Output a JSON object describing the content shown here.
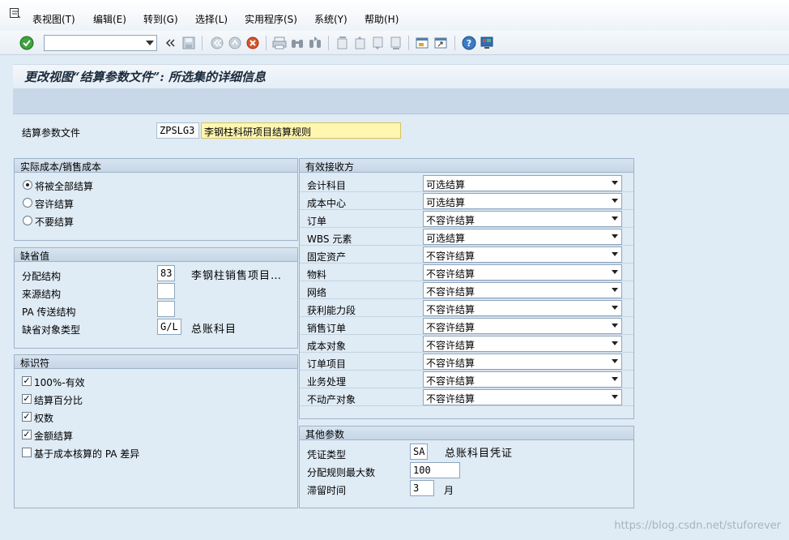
{
  "menu": {
    "items": [
      "表视图(T)",
      "编辑(E)",
      "转到(G)",
      "选择(L)",
      "实用程序(S)",
      "系统(Y)",
      "帮助(H)"
    ]
  },
  "toolbar": {
    "command_value": ""
  },
  "page": {
    "title": "更改视图“结算参数文件”: 所选集的详细信息"
  },
  "profile": {
    "label": "结算参数文件",
    "code": "ZPSLG3",
    "description": "李钢柱科研项目结算规则"
  },
  "actual_cost": {
    "title": "实际成本/销售成本",
    "options": [
      {
        "label": "将被全部结算",
        "selected": true
      },
      {
        "label": "容许结算",
        "selected": false
      },
      {
        "label": "不要结算",
        "selected": false
      }
    ]
  },
  "defaults": {
    "title": "缺省值",
    "rows": [
      {
        "label": "分配结构",
        "value": "83",
        "desc": "李钢柱销售项目…"
      },
      {
        "label": "来源结构",
        "value": "",
        "desc": ""
      },
      {
        "label": "PA 传送结构",
        "value": "",
        "desc": ""
      },
      {
        "label": "缺省对象类型",
        "value": "G/L",
        "desc": "总账科目"
      }
    ]
  },
  "indicators": {
    "title": "标识符",
    "items": [
      {
        "label": "100%-有效",
        "checked": true
      },
      {
        "label": "结算百分比",
        "checked": true
      },
      {
        "label": "权数",
        "checked": true
      },
      {
        "label": "金额结算",
        "checked": true
      },
      {
        "label": "基于成本核算的 PA 差异",
        "checked": false
      }
    ]
  },
  "receivers": {
    "title": "有效接收方",
    "rows": [
      {
        "label": "会计科目",
        "value": "可选结算"
      },
      {
        "label": "成本中心",
        "value": "可选结算"
      },
      {
        "label": "订单",
        "value": "不容许结算"
      },
      {
        "label": "WBS 元素",
        "value": "可选结算"
      },
      {
        "label": "固定资产",
        "value": "不容许结算"
      },
      {
        "label": "物料",
        "value": "不容许结算"
      },
      {
        "label": "网络",
        "value": "不容许结算"
      },
      {
        "label": "获利能力段",
        "value": "不容许结算"
      },
      {
        "label": "销售订单",
        "value": "不容许结算"
      },
      {
        "label": "成本对象",
        "value": "不容许结算"
      },
      {
        "label": "订单项目",
        "value": "不容许结算"
      },
      {
        "label": "业务处理",
        "value": "不容许结算"
      },
      {
        "label": "不动产对象",
        "value": "不容许结算"
      }
    ]
  },
  "other": {
    "title": "其他参数",
    "doc_type_label": "凭证类型",
    "doc_type_value": "SA",
    "doc_type_desc": "总账科目凭证",
    "max_rules_label": "分配规则最大数",
    "max_rules_value": "100",
    "residence_label": "滞留时间",
    "residence_value": "3",
    "residence_unit": "月"
  },
  "watermark": "https://blog.csdn.net/stuforever"
}
